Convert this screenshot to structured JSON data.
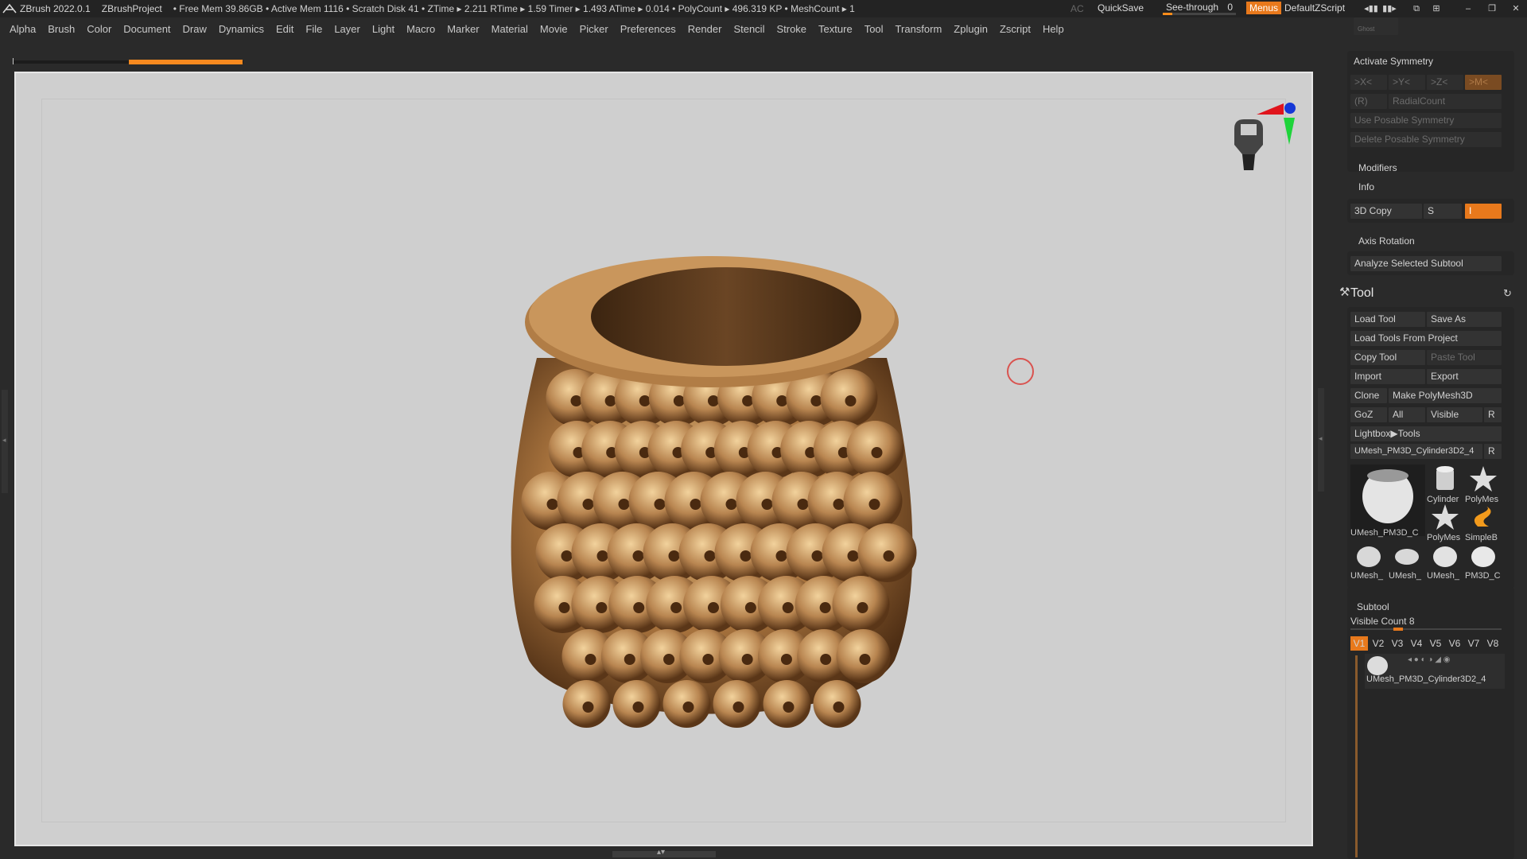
{
  "titlebar": {
    "app": "ZBrush 2022.0.1",
    "project": "ZBrushProject",
    "stats": "• Free Mem 39.86GB • Active Mem 1116 • Scratch Disk 41 • ZTime ▸ 2.211 RTime ▸ 1.59 Timer ▸ 1.493 ATime ▸ 0.014 • PolyCount ▸ 496.319 KP • MeshCount ▸ 1",
    "ac": "AC",
    "quicksave": "QuickSave",
    "see_through_label": "See-through",
    "see_through_value": "0",
    "see_through_level": 0.0,
    "menus": "Menus",
    "script": "DefaultZScript",
    "accent_color": "#e8791c"
  },
  "menubar": [
    "Alpha",
    "Brush",
    "Color",
    "Document",
    "Draw",
    "Dynamics",
    "Edit",
    "File",
    "Layer",
    "Light",
    "Macro",
    "Marker",
    "Material",
    "Movie",
    "Picker",
    "Preferences",
    "Render",
    "Stencil",
    "Stroke",
    "Texture",
    "Tool",
    "Transform",
    "Zplugin",
    "Zscript",
    "Help"
  ],
  "symmetry": {
    "ghost": "Ghost",
    "activate": "Activate Symmetry",
    "x": ">X<",
    "y": ">Y<",
    "z": ">Z<",
    "m": ">M<",
    "r": "(R)",
    "radial": "RadialCount",
    "use_posable": "Use Posable Symmetry",
    "delete_posable": "Delete Posable Symmetry"
  },
  "modifiers": "Modifiers",
  "info": "Info",
  "copy3d": {
    "label": "3D Copy",
    "s": "S",
    "i": "I"
  },
  "axis_rotation": "Axis Rotation",
  "analyze": "Analyze Selected Subtool",
  "tool": {
    "title": "Tool",
    "load_tool": "Load Tool",
    "save_as": "Save As",
    "load_from_project": "Load Tools From Project",
    "copy_tool": "Copy Tool",
    "paste_tool": "Paste Tool",
    "import": "Import",
    "export": "Export",
    "clone": "Clone",
    "make_polymesh": "Make PolyMesh3D",
    "goz": "GoZ",
    "all": "All",
    "visible": "Visible",
    "r": "R",
    "lightbox": "Lightbox▶Tools",
    "current": "UMesh_PM3D_Cylinder3D2_4",
    "current_r": "R",
    "thumbs": [
      {
        "name": "UMesh_PM3D_C",
        "icon": "umesh-main-icon"
      },
      {
        "name": "Cylinder",
        "icon": "cylinder-icon"
      },
      {
        "name": "PolyMes",
        "icon": "polymesh-star-icon"
      },
      {
        "name": "PolyMes",
        "icon": "polymesh-star-icon"
      },
      {
        "name": "SimpleB",
        "icon": "simplebrush-icon"
      },
      {
        "name": "UMesh_",
        "icon": "umesh-small-icon"
      },
      {
        "name": "UMesh_",
        "icon": "umesh-small-icon"
      },
      {
        "name": "UMesh_",
        "icon": "umesh-small-icon"
      },
      {
        "name": "PM3D_C",
        "icon": "pm3d-small-icon"
      }
    ]
  },
  "subtool": {
    "title": "Subtool",
    "visible_count_label": "Visible Count",
    "visible_count": "8",
    "tabs": [
      "V1",
      "V2",
      "V3",
      "V4",
      "V5",
      "V6",
      "V7",
      "V8"
    ],
    "active_tab": "V1",
    "item": "UMesh_PM3D_Cylinder3D2_4"
  }
}
